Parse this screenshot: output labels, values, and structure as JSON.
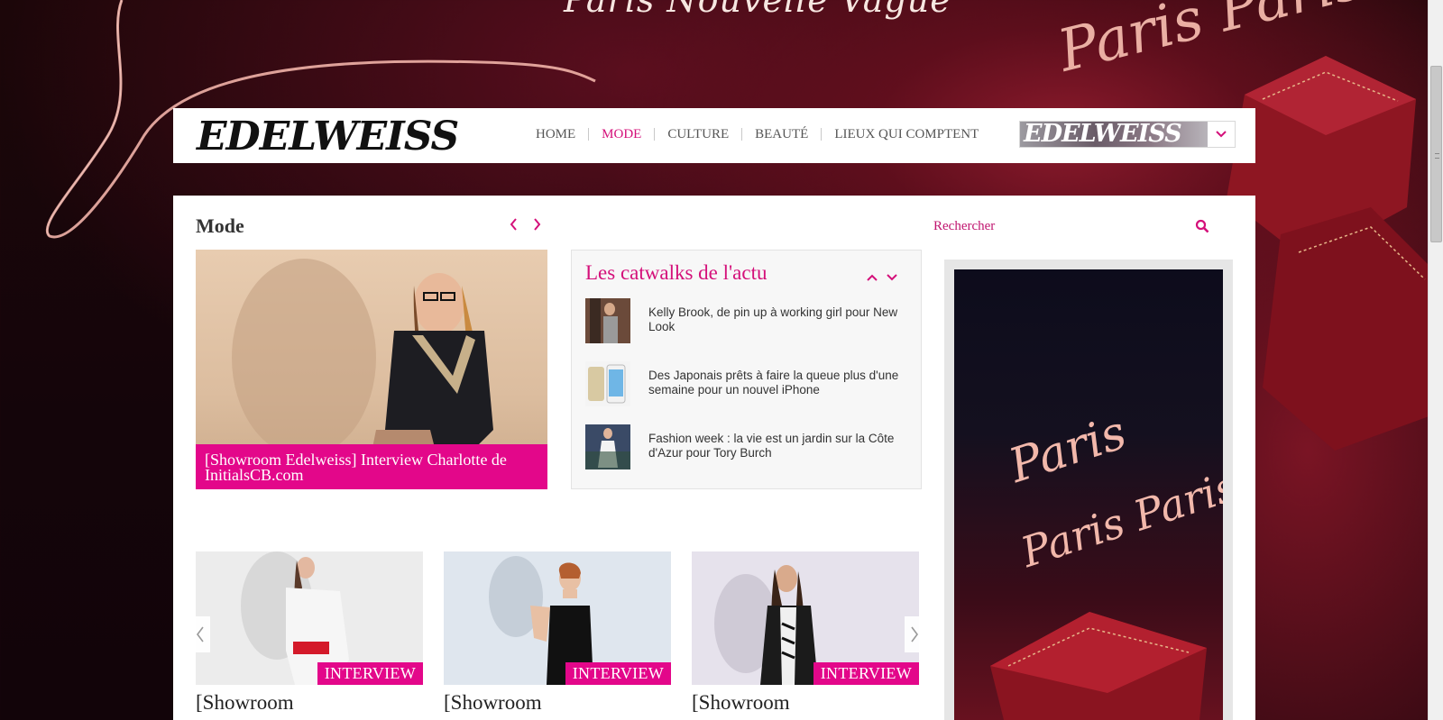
{
  "background": {
    "top_script": "Paris Nouvelle Vague",
    "right_script": "Paris Paris"
  },
  "header": {
    "logo": "EDELWEISS",
    "nav": [
      {
        "label": "HOME",
        "active": false
      },
      {
        "label": "MODE",
        "active": true
      },
      {
        "label": "CULTURE",
        "active": false
      },
      {
        "label": "BEAUTÉ",
        "active": false
      },
      {
        "label": "LIEUX QUI COMPTENT",
        "active": false
      }
    ],
    "edition_logo": "EDELWEISS",
    "edition_icon": "chevron-down-icon"
  },
  "main": {
    "section_title": "Mode",
    "featured": {
      "caption": "[Showroom Edelweiss] Interview Charlotte de InitialsCB.com"
    },
    "catwalks": {
      "title": "Les catwalks de l'actu",
      "items": [
        {
          "text": "Kelly Brook, de pin up à working girl pour New Look"
        },
        {
          "text": "Des Japonais prêts à faire la queue plus d'une semaine pour un nouvel iPhone"
        },
        {
          "text": "Fashion week : la vie est un jardin sur la Côte d'Azur pour Tory Burch"
        }
      ]
    },
    "search": {
      "placeholder": "Rechercher"
    },
    "ad": {
      "script_line1": "Paris",
      "script_line2": "Paris Paris"
    },
    "cards": [
      {
        "badge": "INTERVIEW",
        "title": "[Showroom"
      },
      {
        "badge": "INTERVIEW",
        "title": "[Showroom"
      },
      {
        "badge": "INTERVIEW",
        "title": "[Showroom"
      }
    ]
  },
  "colors": {
    "accent": "#e3078a",
    "accent_text": "#d4107a"
  }
}
